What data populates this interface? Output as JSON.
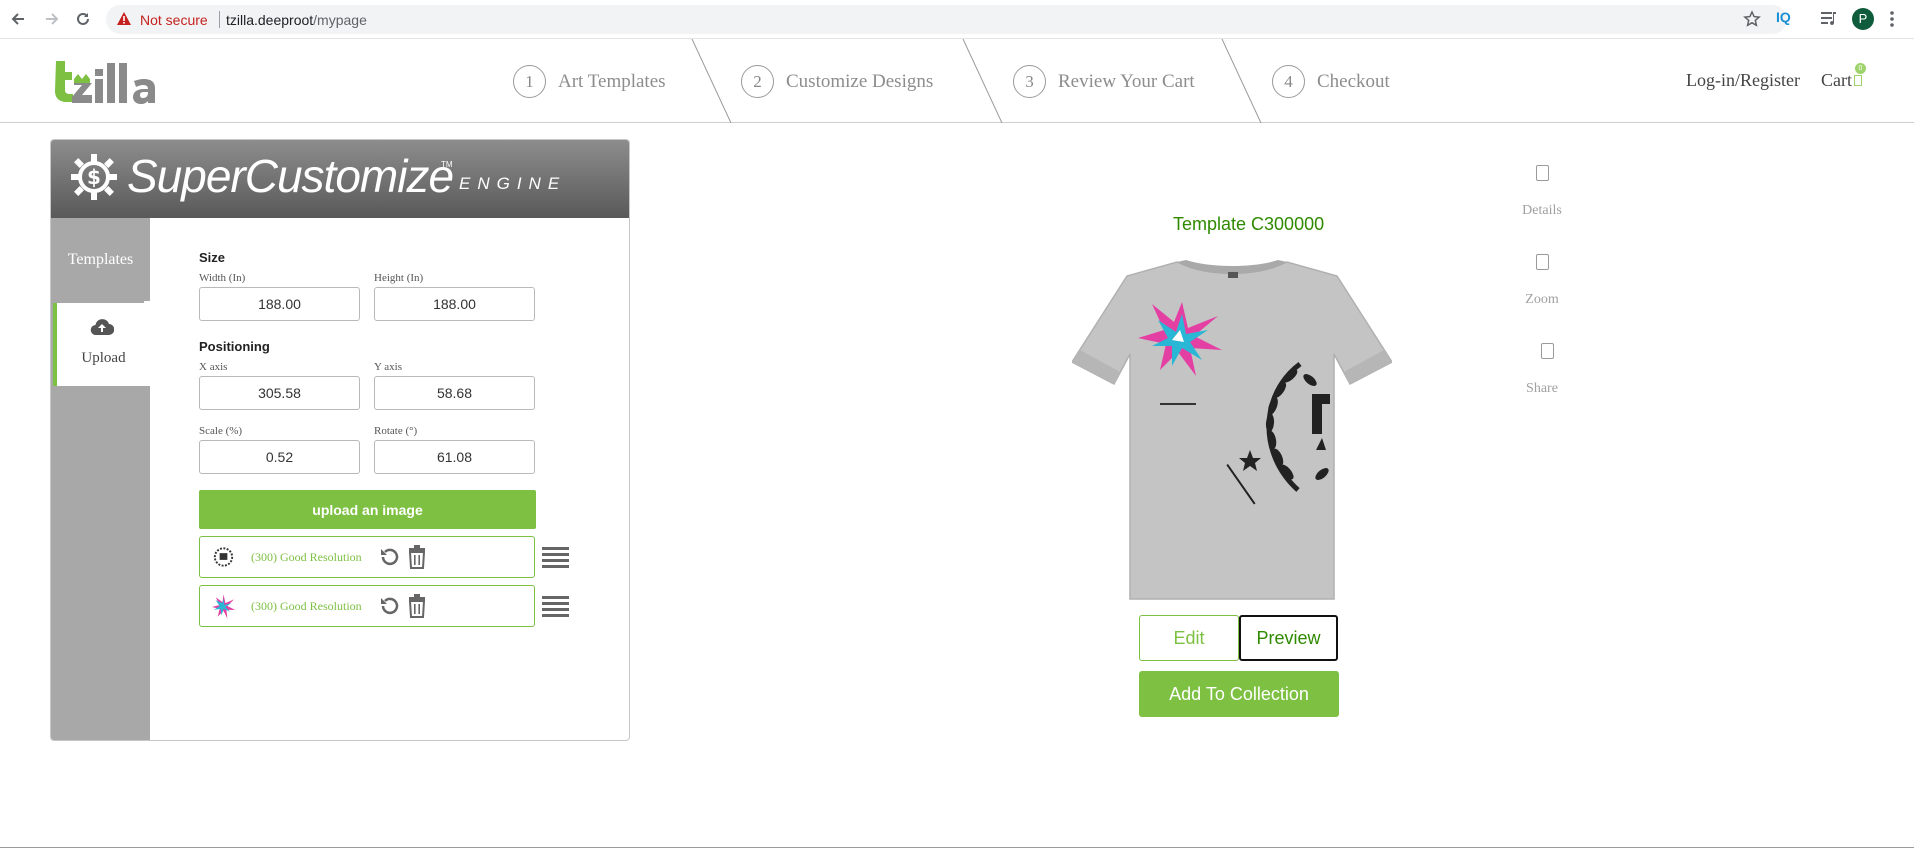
{
  "browser": {
    "security_label": "Not secure",
    "url_host": "tzilla.deeproot",
    "url_path": "/mypage",
    "extension_label": "IQ",
    "profile_initial": "P"
  },
  "header": {
    "logo_text": "tzilla",
    "steps": [
      {
        "number": "1",
        "label": "Art Templates"
      },
      {
        "number": "2",
        "label": "Customize Designs"
      },
      {
        "number": "3",
        "label": "Review Your Cart"
      },
      {
        "number": "4",
        "label": "Checkout"
      }
    ],
    "login_label": "Log-in/Register",
    "cart_label": "Cart",
    "cart_count": "0"
  },
  "engine": {
    "title": "SuperCustomize",
    "trademark": "TM",
    "subtitle": "ENGINE",
    "tabs": [
      {
        "label": "Templates"
      },
      {
        "label": "Upload"
      }
    ],
    "size": {
      "title": "Size",
      "width_label": "Width (In)",
      "width_value": "188.00",
      "height_label": "Height (In)",
      "height_value": "188.00"
    },
    "positioning": {
      "title": "Positioning",
      "x_label": "X axis",
      "x_value": "305.58",
      "y_label": "Y axis",
      "y_value": "58.68",
      "scale_label": "Scale (%)",
      "scale_value": "0.52",
      "rotate_label": "Rotate (°)",
      "rotate_value": "61.08"
    },
    "upload_button": "upload an image",
    "layers": [
      {
        "resolution": "(300) Good Resolution",
        "thumb_icon": "wreath-logo-thumbnail"
      },
      {
        "resolution": "(300) Good Resolution",
        "thumb_icon": "star-burst-thumbnail"
      }
    ]
  },
  "preview": {
    "template_title": "Template C300000",
    "edit_label": "Edit",
    "preview_label": "Preview",
    "collection_label": "Add To Collection",
    "shirt_color": "#c4c4c4"
  },
  "tools": [
    {
      "label": "Details"
    },
    {
      "label": "Zoom"
    },
    {
      "label": "Share"
    }
  ],
  "colors": {
    "accent": "#7dc042",
    "title_green": "#2f8a00",
    "sidebar_gray": "#a8a8a8"
  }
}
